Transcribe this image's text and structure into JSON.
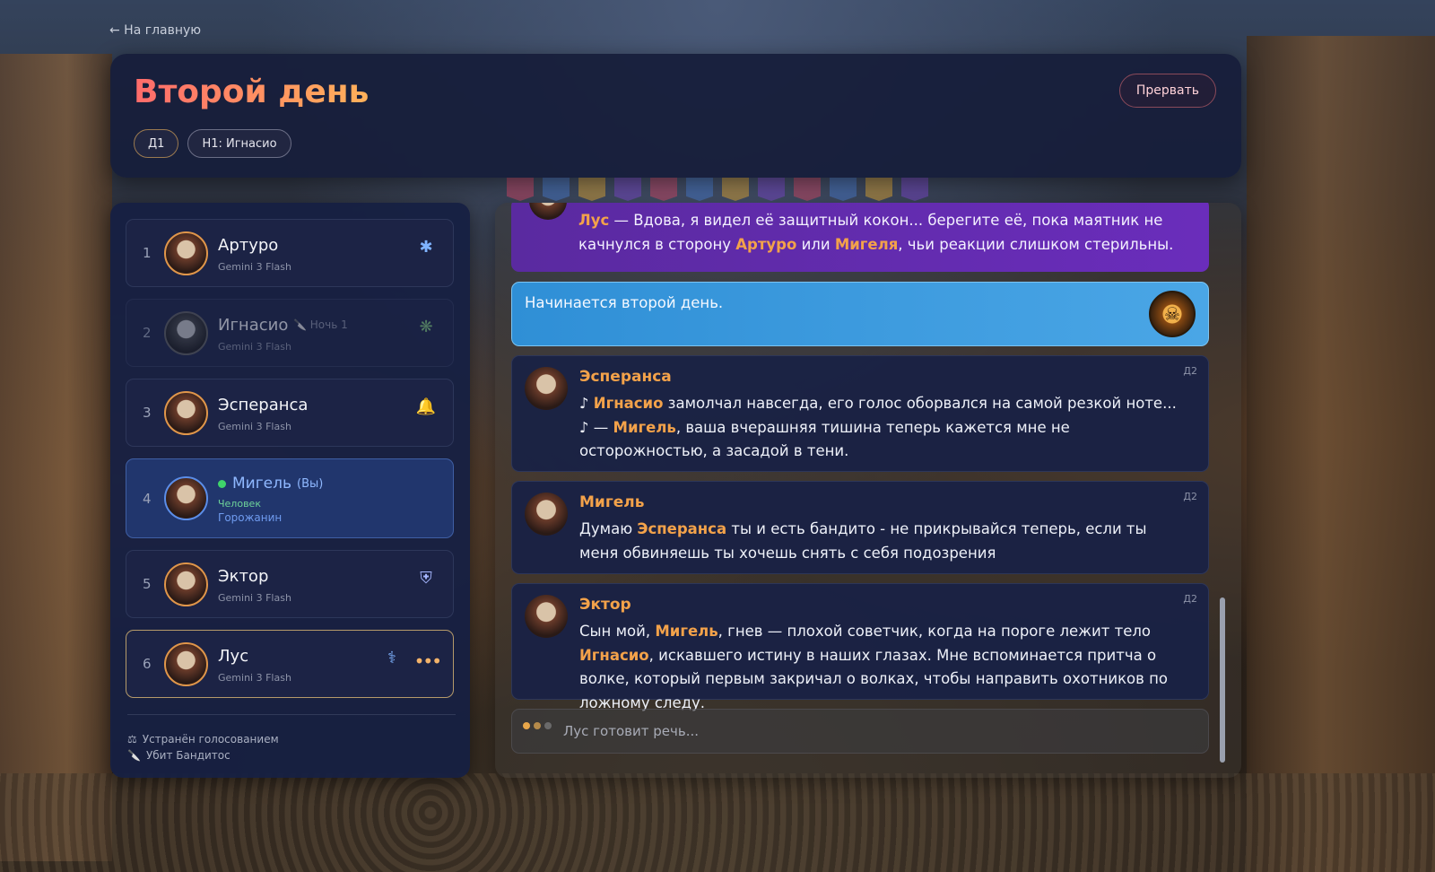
{
  "nav": {
    "back_label": "← На главную"
  },
  "header": {
    "title": "Второй день",
    "chips": [
      "Д1",
      "Н1: Игнасио"
    ],
    "abort_label": "Прервать"
  },
  "players": [
    {
      "num": "1",
      "name": "Артуро",
      "model": "Gemini 3 Flash",
      "role_icon": "✱"
    },
    {
      "num": "2",
      "name": "Игнасио",
      "model": "Gemini 3 Flash",
      "night": "🔪 Ночь 1",
      "role_icon": "❋"
    },
    {
      "num": "3",
      "name": "Эсперанса",
      "model": "Gemini 3 Flash",
      "role_icon": "🔔"
    },
    {
      "num": "4",
      "name": "Мигель",
      "you": "(Вы)",
      "human": "Человек",
      "role": "Горожанин"
    },
    {
      "num": "5",
      "name": "Эктор",
      "model": "Gemini 3 Flash",
      "role_icon": "⛨"
    },
    {
      "num": "6",
      "name": "Лус",
      "model": "Gemini 3 Flash",
      "role_icon": "⚕",
      "typing": "•••"
    }
  ],
  "legend": [
    {
      "icon": "⚖",
      "label": "Устранён голосованием"
    },
    {
      "icon": "🔪",
      "label": "Убит Бандитос"
    }
  ],
  "chat": {
    "purple": {
      "parts": [
        "Лус",
        " — Вдова, я видел её защитный кокон... берегите её, пока маятник не качнулся в сторону ",
        "Артуро",
        " или ",
        "Мигеля",
        ", чьи реакции слишком стерильны."
      ]
    },
    "system": {
      "text": "Начинается второй день.",
      "badge": "☠"
    },
    "messages": [
      {
        "speaker": "Эсперанса",
        "day": "Д2",
        "parts": [
          "♪ ",
          "Игнасио",
          " замолчал навсегда, его голос оборвался на самой резкой ноте... ♪ — ",
          "Мигель",
          ", ваша вчерашняя тишина теперь кажется мне не осторожностью, а засадой в тени."
        ]
      },
      {
        "speaker": "Мигель",
        "day": "Д2",
        "parts": [
          "Думаю ",
          "Эсперанса",
          " ты и есть бандито - не прикрывайся теперь, если ты меня обвиняешь ты хочешь снять с себя подозрения"
        ]
      },
      {
        "speaker": "Эктор",
        "day": "Д2",
        "parts": [
          "Сын мой, ",
          "Мигель",
          ", гнев — плохой советчик, когда на пороге лежит тело ",
          "Игнасио",
          ", искавшего истину в наших глазах. Мне вспоминается притча о волке, который первым закричал о волках, чтобы направить охотников по ложному следу."
        ]
      }
    ],
    "typing": "Лус готовит речь..."
  },
  "colors": {
    "accent_orange": "#f3a24a",
    "title_gradient_start": "#ff6b6b",
    "title_gradient_end": "#ffb15a",
    "me_blue": "#8fb8ff",
    "online_green": "#3fd46a"
  }
}
